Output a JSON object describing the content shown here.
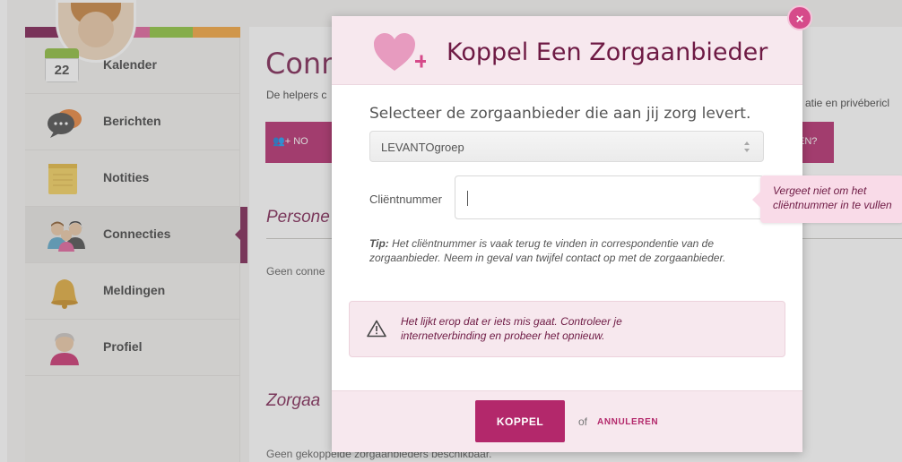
{
  "sidebar": {
    "items": [
      {
        "label": "Kalender",
        "icon": "calendar-icon",
        "calendar_day": "22"
      },
      {
        "label": "Berichten",
        "icon": "chat-bubbles-icon"
      },
      {
        "label": "Notities",
        "icon": "notepad-icon"
      },
      {
        "label": "Connecties",
        "icon": "people-icon",
        "active": true
      },
      {
        "label": "Meldingen",
        "icon": "bell-icon"
      },
      {
        "label": "Profiel",
        "icon": "profile-avatar-icon"
      }
    ]
  },
  "background": {
    "title": "Conn",
    "subtitle_left": "De helpers c",
    "subtitle_right": "atie en privébericl",
    "button_left": "NO",
    "button_right": "EN?",
    "section_personal": "Persone",
    "personal_empty": "Geen conne",
    "section_providers": "Zorgaa",
    "providers_empty": "Geen gekoppelde zorgaanbieders beschikbaar."
  },
  "modal": {
    "title": "Koppel Een Zorgaanbieder",
    "close_label": "×",
    "select_label": "Selecteer de zorgaanbieder die aan jij zorg levert.",
    "select_value": "LEVANTOgroep",
    "client_label": "Cliëntnummer",
    "client_value": "",
    "tooltip": "Vergeet niet om het cliëntnummer in te vullen",
    "tip_label": "Tip:",
    "tip_text": "Het cliëntnummer is vaak terug te vinden in correspondentie van de zorgaanbieder. Neem in geval van twijfel contact op met de zorgaanbieder.",
    "alert_text": "Het lijkt erop dat er iets mis gaat. Controleer je internetverbinding en probeer het opnieuw.",
    "submit_label": "KOPPEL",
    "or_text": "of",
    "cancel_label": "ANNULEREN"
  },
  "colors": {
    "brand": "#7b1f4f",
    "accent": "#b3286b",
    "pink_light": "#f7e8ee"
  }
}
